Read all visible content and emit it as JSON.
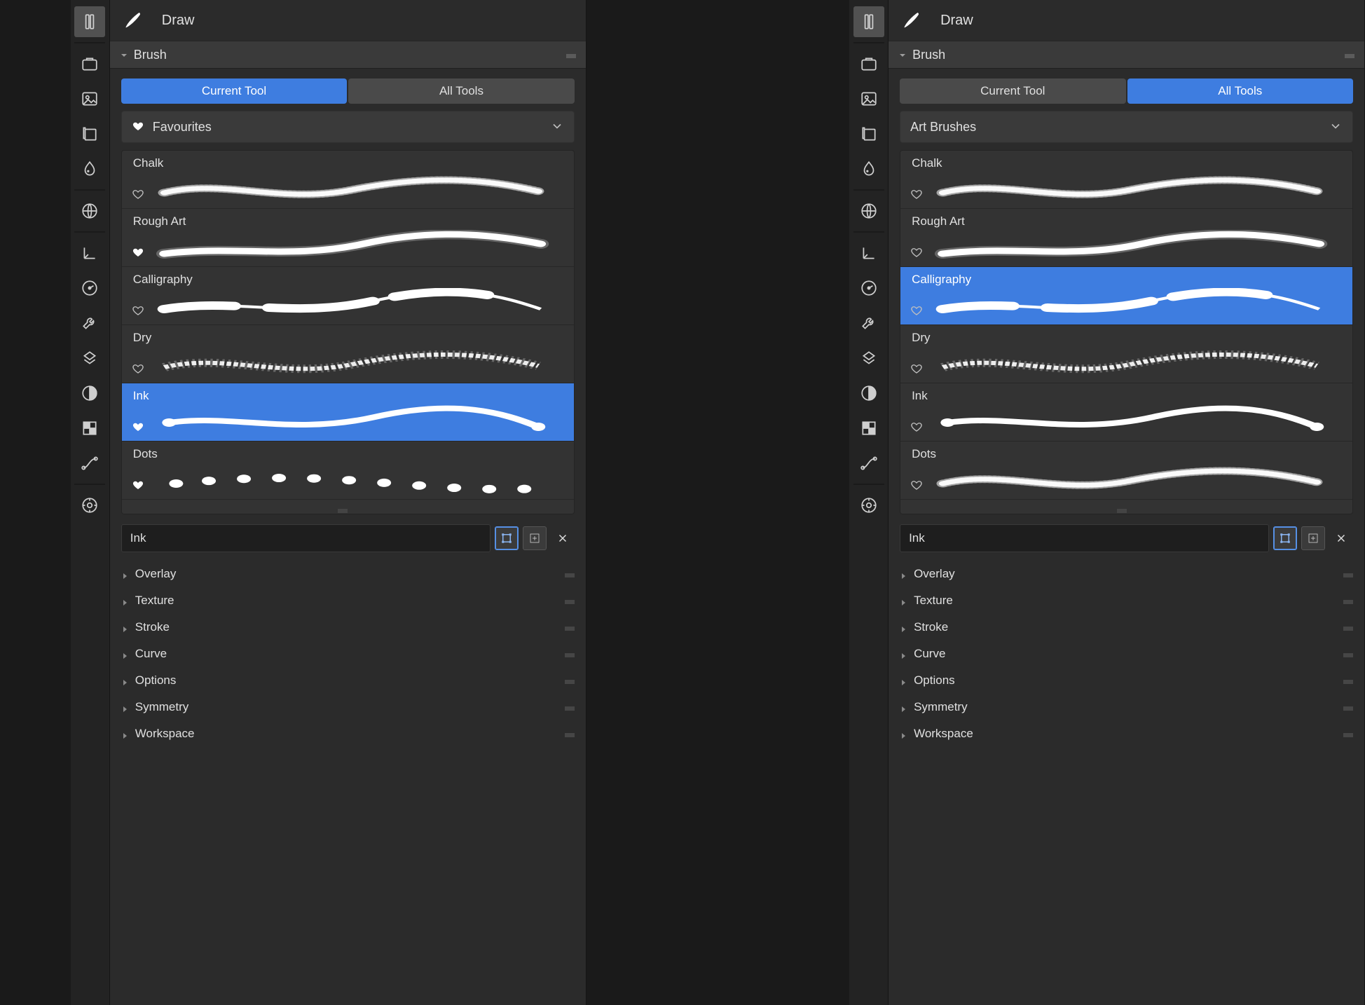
{
  "panes": [
    {
      "header_title": "Draw",
      "section_title": "Brush",
      "tabs": {
        "current": "Current Tool",
        "all": "All Tools",
        "active": "current"
      },
      "dropdown": {
        "show_heart": true,
        "label": "Favourites"
      },
      "brushes": [
        {
          "name": "Chalk",
          "stroke": "chalk",
          "fav": false,
          "edit_icon": "pencil",
          "selected": false
        },
        {
          "name": "Rough Art",
          "stroke": "rough",
          "fav": true,
          "edit_icon": "pencil",
          "selected": false
        },
        {
          "name": "Calligraphy",
          "stroke": "calli",
          "fav": false,
          "edit_icon": "pencil",
          "selected": false
        },
        {
          "name": "Dry",
          "stroke": "dry",
          "fav": false,
          "edit_icon": "pencil",
          "selected": false
        },
        {
          "name": "Ink",
          "stroke": "ink",
          "fav": true,
          "edit_icon": "pencil",
          "selected": true
        },
        {
          "name": "Dots",
          "stroke": "dots",
          "fav": true,
          "edit_icon": "pencil",
          "selected": false
        }
      ],
      "name_field": "Ink",
      "subsections": [
        "Overlay",
        "Texture",
        "Stroke",
        "Curve",
        "Options",
        "Symmetry",
        "Workspace"
      ]
    },
    {
      "header_title": "Draw",
      "section_title": "Brush",
      "tabs": {
        "current": "Current Tool",
        "all": "All Tools",
        "active": "all"
      },
      "dropdown": {
        "show_heart": false,
        "label": "Art Brushes"
      },
      "brushes": [
        {
          "name": "Chalk",
          "stroke": "chalk",
          "fav": false,
          "edit_icon": "pencil",
          "selected": false
        },
        {
          "name": "Rough Art",
          "stroke": "rough",
          "fav": false,
          "edit_icon": "stamp",
          "selected": false
        },
        {
          "name": "Calligraphy",
          "stroke": "calli",
          "fav": false,
          "edit_icon": "drop",
          "selected": true
        },
        {
          "name": "Dry",
          "stroke": "dry",
          "fav": false,
          "edit_icon": "drop",
          "selected": false
        },
        {
          "name": "Ink",
          "stroke": "ink",
          "fav": false,
          "edit_icon": "blob",
          "selected": false
        },
        {
          "name": "Dots",
          "stroke": "chalk",
          "fav": false,
          "edit_icon": "pencil",
          "selected": false
        }
      ],
      "name_field": "Ink",
      "subsections": [
        "Overlay",
        "Texture",
        "Stroke",
        "Curve",
        "Options",
        "Symmetry",
        "Workspace"
      ]
    }
  ],
  "toolbar_icons": [
    "tool-active",
    "briefcase",
    "image",
    "gallery",
    "droplet",
    "globe",
    "axes",
    "gauge",
    "wrench",
    "diagram",
    "contrast",
    "checker",
    "curve-tool",
    "radial"
  ]
}
